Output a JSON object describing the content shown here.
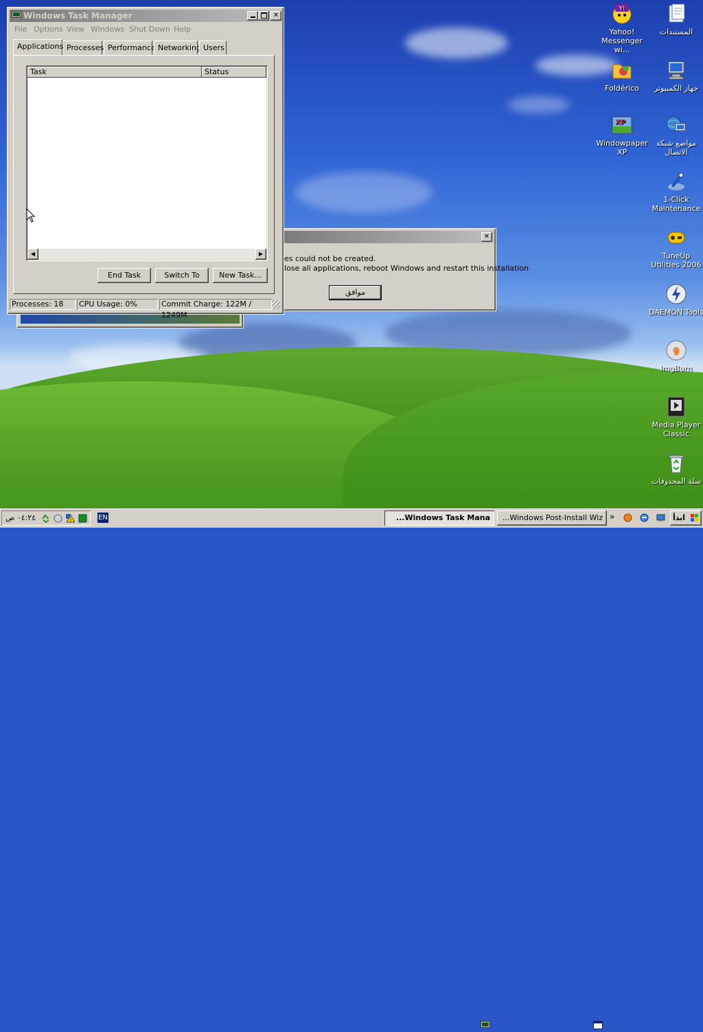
{
  "desktop": {
    "icons": [
      {
        "label": "المستندات",
        "icon": "documents-icon"
      },
      {
        "label": "Yahoo! Messenger wi...",
        "icon": "yahoo-messenger-icon"
      },
      {
        "label": "جهاز الكمبيوتر",
        "icon": "my-computer-icon"
      },
      {
        "label": "Foldérico",
        "icon": "folderico-icon"
      },
      {
        "label": "مواضع شبكة الاتصال",
        "icon": "network-places-icon"
      },
      {
        "label": "Windowpaper XP",
        "icon": "windowpaper-icon"
      },
      {
        "label": "1-Click Maintenance",
        "icon": "maintenance-icon"
      },
      {
        "label": "TuneUp Utilities 2006",
        "icon": "tuneup-icon"
      },
      {
        "label": "DAEMON Tools",
        "icon": "daemon-tools-icon"
      },
      {
        "label": "ImgBurn",
        "icon": "imgburn-icon"
      },
      {
        "label": "Media Player Classic",
        "icon": "media-player-classic-icon"
      },
      {
        "label": "سلة المحذوفات",
        "icon": "recycle-bin-icon"
      }
    ]
  },
  "task_manager": {
    "title": "Windows Task Manager",
    "menu": [
      "File",
      "Options",
      "View",
      "Windows",
      "Shut Down",
      "Help"
    ],
    "tabs": [
      "Applications",
      "Processes",
      "Performance",
      "Networking",
      "Users"
    ],
    "selected_tab": "Applications",
    "columns": {
      "task": "Task",
      "status": "Status"
    },
    "buttons": {
      "end_task": "End Task",
      "switch_to": "Switch To",
      "new_task": "New Task..."
    },
    "status": {
      "processes": "Processes: 18",
      "cpu": "CPU Usage: 0%",
      "commit": "Commit Charge: 122M / 1249M"
    }
  },
  "error_dialog": {
    "line1": "es could not be created.",
    "line2": "lose all applications, reboot Windows and restart this installation",
    "ok_button": "موافق"
  },
  "taskbar": {
    "start_label": "ابدأ",
    "chevron": "»",
    "tasks": [
      {
        "label": "Windows Task Mana...",
        "pressed": true
      },
      {
        "label": "Windows Post-Install Wiz...",
        "pressed": false
      }
    ],
    "language": "EN",
    "clock": "٠٤:٢٤ ص"
  }
}
